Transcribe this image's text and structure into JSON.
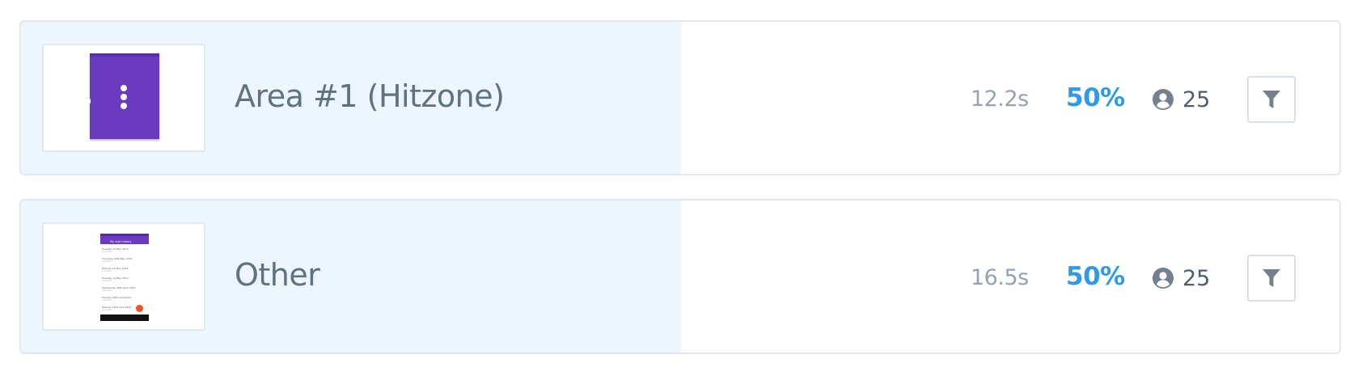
{
  "rows": [
    {
      "title": "Area #1 (Hitzone)",
      "time": "12.2s",
      "percent": "50%",
      "users": "25",
      "thumbnail": "purple-hitzone",
      "filter_icon": "funnel-icon",
      "user_icon": "user-circle-icon"
    },
    {
      "title": "Other",
      "time": "16.5s",
      "percent": "50%",
      "users": "25",
      "thumbnail": "mobile-app-screenshot",
      "filter_icon": "funnel-icon",
      "user_icon": "user-circle-icon",
      "preview": {
        "app_title": "My visit history",
        "items": [
          {
            "primary": "Tuesday 13 May 2014",
            "secondary": "1.0 hours"
          },
          {
            "primary": "Thursday 29th May 2014",
            "secondary": "2.0 hours"
          },
          {
            "primary": "Monday 19 May 2014",
            "secondary": "1.5 hours"
          },
          {
            "primary": "Tuesday 14 May 2014",
            "secondary": "1.0 hours"
          },
          {
            "primary": "Wednesday 30th April 2014",
            "secondary": "3.0 hours"
          },
          {
            "primary": "Monday 28th April 2014",
            "secondary": "1.0 hours"
          },
          {
            "primary": "Monday 14th April 2014",
            "secondary": "2.0 hours"
          }
        ]
      }
    }
  ],
  "colors": {
    "row_highlight": "#edf5fe",
    "title_text": "#5f7282",
    "time_text": "#93a3b4",
    "percent_text": "#2f9be8",
    "count_text": "#4d5e6e",
    "icon": "#73808d",
    "hitzone_purple": "#6a3bbf",
    "fab_orange": "#f4511e"
  }
}
